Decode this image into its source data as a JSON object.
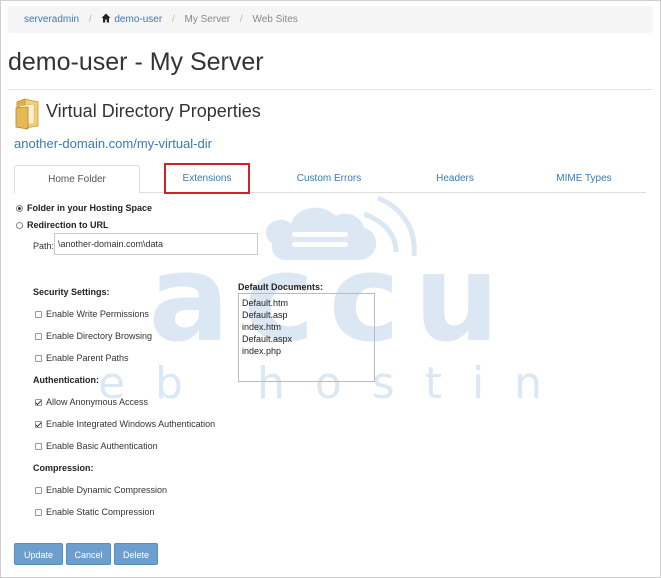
{
  "breadcrumb": {
    "items": [
      "serveradmin",
      "demo-user",
      "My Server",
      "Web Sites"
    ]
  },
  "page": {
    "title": "demo-user - My Server",
    "section_title": "Virtual Directory Properties",
    "path_link": "another-domain.com/my-virtual-dir"
  },
  "tabs": [
    "Home Folder",
    "Extensions",
    "Custom Errors",
    "Headers",
    "MIME Types"
  ],
  "active_tab": "Home Folder",
  "highlighted_tab": "Extensions",
  "folder_options": {
    "hosting_space": "Folder in your Hosting Space",
    "redirection": "Redirection to URL",
    "selected": "Folder in your Hosting Space"
  },
  "path": {
    "label": "Path:",
    "value": "\\another-domain.com\\data"
  },
  "security": {
    "label": "Security Settings:",
    "options": [
      {
        "label": "Enable Write Permissions",
        "checked": false
      },
      {
        "label": "Enable Directory Browsing",
        "checked": false
      },
      {
        "label": "Enable Parent Paths",
        "checked": false
      }
    ]
  },
  "authentication": {
    "label": "Authentication:",
    "options": [
      {
        "label": "Allow Anonymous Access",
        "checked": true
      },
      {
        "label": "Enable Integrated Windows Authentication",
        "checked": true
      },
      {
        "label": "Enable Basic Authentication",
        "checked": false
      }
    ]
  },
  "compression": {
    "label": "Compression:",
    "options": [
      {
        "label": "Enable Dynamic Compression",
        "checked": false
      },
      {
        "label": "Enable Static Compression",
        "checked": false
      }
    ]
  },
  "default_documents": {
    "label": "Default Documents:",
    "items": [
      "Default.htm",
      "Default.asp",
      "index.htm",
      "Default.aspx",
      "index.php"
    ]
  },
  "buttons": {
    "update": "Update",
    "cancel": "Cancel",
    "delete": "Delete"
  },
  "watermark": {
    "brand": "accu",
    "tagline": "web hosting"
  },
  "colors": {
    "accent": "#3a7ab8",
    "button": "#6c9fce",
    "highlight": "#d0202a",
    "watermark": "#dbe8f4"
  }
}
